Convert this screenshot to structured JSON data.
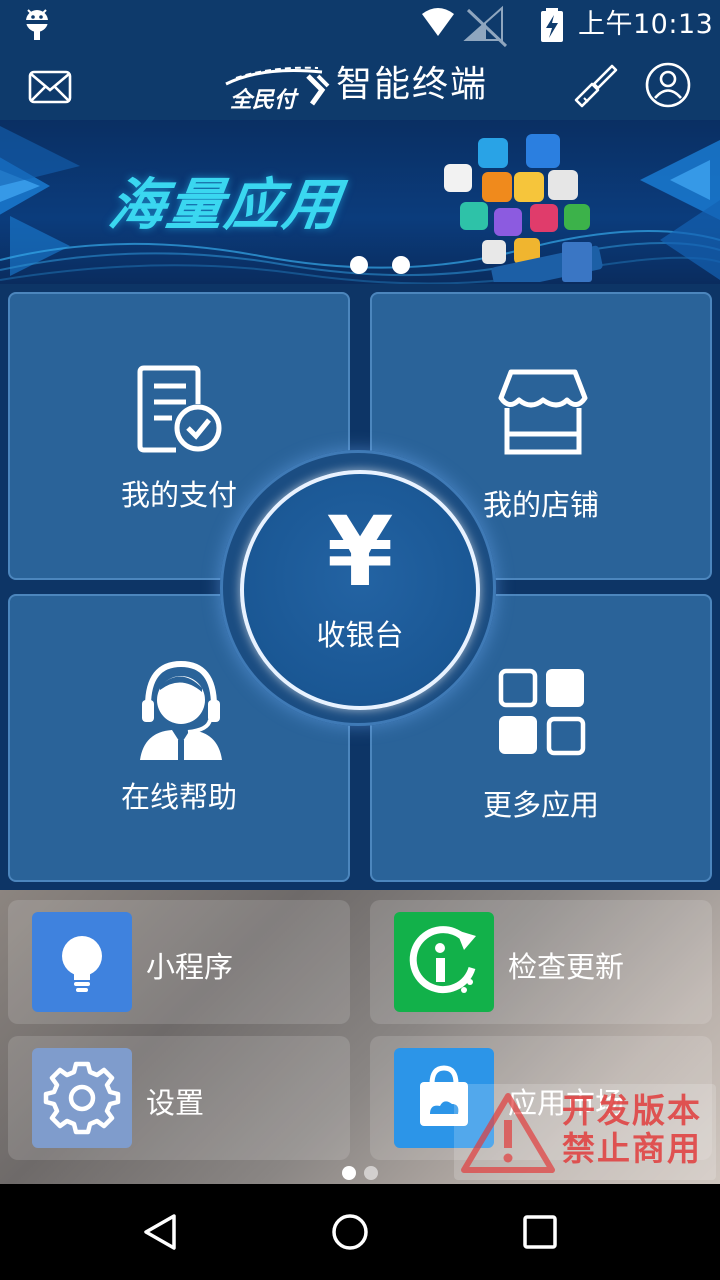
{
  "status_bar": {
    "time": "上午10:13",
    "icons": [
      "android-icon",
      "wifi-icon",
      "no-signal-icon",
      "battery-charging-icon"
    ]
  },
  "header": {
    "logo_text": "全民付",
    "title": "智能终端",
    "icons": [
      "mail-icon",
      "brush-icon",
      "user-icon"
    ]
  },
  "banner": {
    "headline": "海量应用",
    "page_count": 2,
    "active_page": 1
  },
  "main_tiles": [
    {
      "id": "pay",
      "label": "我的支付",
      "icon": "payment-list-icon"
    },
    {
      "id": "shop",
      "label": "我的店铺",
      "icon": "store-icon"
    },
    {
      "id": "help",
      "label": "在线帮助",
      "icon": "support-agent-icon"
    },
    {
      "id": "more",
      "label": "更多应用",
      "icon": "apps-grid-icon"
    }
  ],
  "center_button": {
    "symbol": "¥",
    "label": "收银台"
  },
  "shortcuts": [
    {
      "id": "mini",
      "label": "小程序",
      "icon": "lightbulb-icon",
      "color": "#3f82de"
    },
    {
      "id": "update",
      "label": "检查更新",
      "icon": "update-info-icon",
      "color": "#12b14a"
    },
    {
      "id": "settings",
      "label": "设置",
      "icon": "gear-icon",
      "color": "#7f9ccc"
    },
    {
      "id": "store",
      "label": "应用市场",
      "icon": "shopping-bag-icon",
      "color": "#2c95e8"
    }
  ],
  "shortcut_pager": {
    "page_count": 2,
    "active_page": 1
  },
  "watermark": {
    "line1": "开发版本",
    "line2": "禁止商用"
  },
  "nav_bar": {
    "icons": [
      "back-icon",
      "home-icon",
      "recents-icon"
    ]
  }
}
